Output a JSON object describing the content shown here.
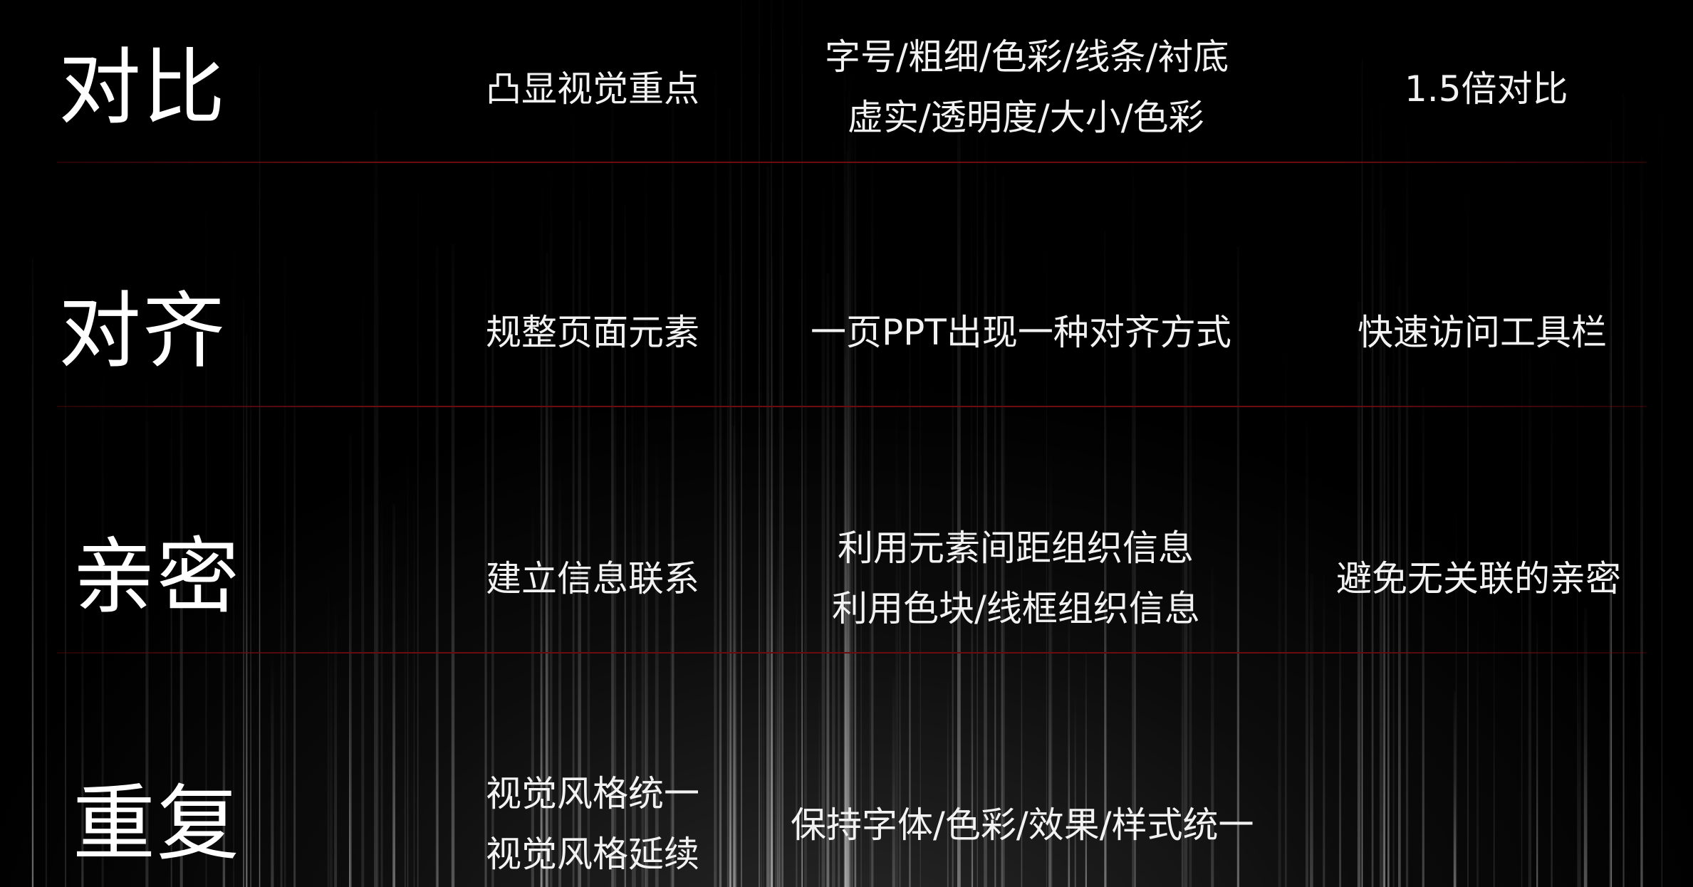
{
  "rows": [
    {
      "heading": "对比",
      "purpose": "凸显视觉重点",
      "method": [
        "字号/粗细/色彩/线条/衬底",
        "虚实/透明度/大小/色彩"
      ],
      "tip": "1.5倍对比"
    },
    {
      "heading": "对齐",
      "purpose": "规整页面元素",
      "method": [
        "一页PPT出现一种对齐方式"
      ],
      "tip": "快速访问工具栏"
    },
    {
      "heading": "亲密",
      "purpose": "建立信息联系",
      "method": [
        "利用元素间距组织信息",
        "利用色块/线框组织信息"
      ],
      "tip": "避免无关联的亲密"
    },
    {
      "heading": "重复",
      "purpose": [
        "视觉风格统一",
        "视觉风格延续"
      ],
      "method": [
        "保持字体/色彩/效果/样式统一"
      ],
      "tip": ""
    }
  ],
  "colors": {
    "background": "#000000",
    "divider": "#6a0c10",
    "text": "#ffffff"
  }
}
